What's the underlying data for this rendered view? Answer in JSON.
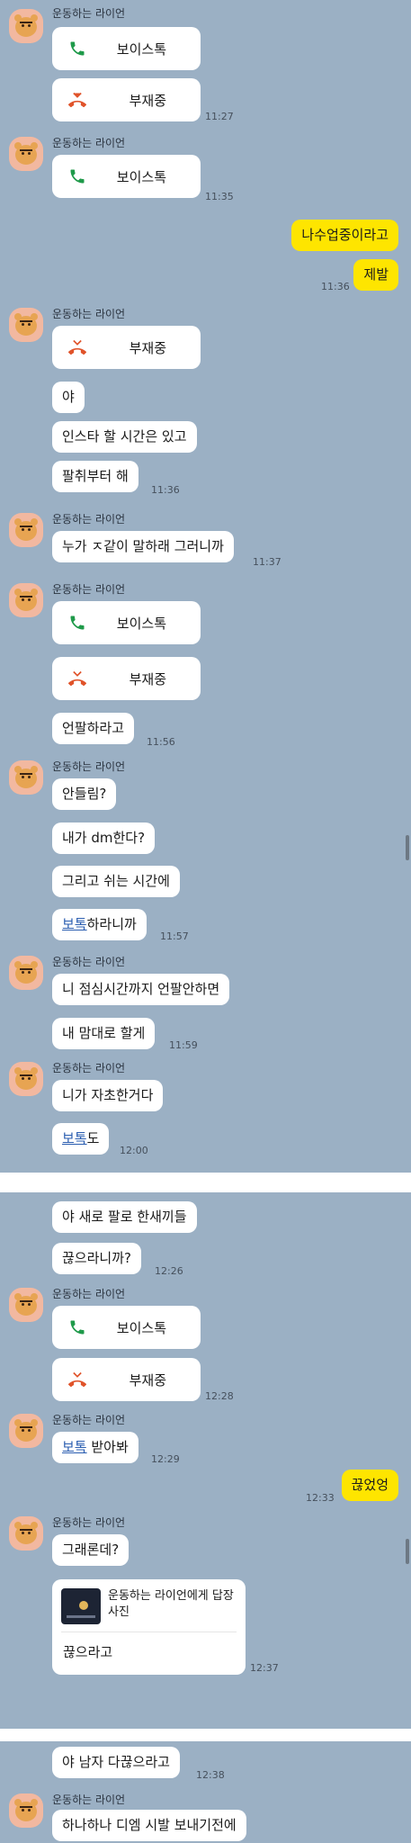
{
  "sender_name": "운동하는 라이언",
  "labels": {
    "voice_talk": "보이스톡",
    "missed": "부재중",
    "bo_tok": "보톡",
    "reply_to": "운동하는 라이언에게 답장",
    "reply_kind": "사진"
  },
  "times": {
    "t1127": "11:27",
    "t1135": "11:35",
    "t1136": "11:36",
    "t1137": "11:37",
    "t1156": "11:56",
    "t1157": "11:57",
    "t1159": "11:59",
    "t1200": "12:00",
    "t1226": "12:26",
    "t1228": "12:28",
    "t1229": "12:29",
    "t1233": "12:33",
    "t1237": "12:37",
    "t1238": "12:38"
  },
  "messages": {
    "m_studying": "나수업중이라고",
    "m_please": "제발",
    "m_ya": "야",
    "m_insta": "인스타 할 시간은 있고",
    "m_follow": "팔취부터 해",
    "m_who": "누가 ㅈ같이 말하래 그러니까",
    "m_unfollow": "언팔하라고",
    "m_cant_hear": "안들림?",
    "m_dm": "내가 dm한다?",
    "m_break": "그리고 쉬는 시간에",
    "m_botok_suffix": "하라니까",
    "m_lunch": "니 점심시간까지 언팔안하면",
    "m_my_way": "내 맘대로 할게",
    "m_choice": "니가 자초한거다",
    "m_botok_do_suffix": "도",
    "m_new_follow": "야 새로 팔로 한새끼들",
    "m_cut": "끊으라니까?",
    "m_take_suffix": " 받아봐",
    "m_cut_mine": "끊었엉",
    "m_so_what": "그래론데?",
    "m_reply_cut": "끊으라고",
    "m_all_male": "야 남자 다끊으라고",
    "m_one_by_one": "하나하나 디엠 시발 보내기전에"
  },
  "colors": {
    "background": "#9bb0c4",
    "my_bubble": "#fee500",
    "their_bubble": "#ffffff",
    "call_green": "#1f9a4a",
    "missed_orange": "#e0532a",
    "link": "#2a5db0"
  },
  "icons": {
    "call": "phone-icon",
    "missed": "missed-call-icon",
    "avatar": "ryan-avatar"
  }
}
